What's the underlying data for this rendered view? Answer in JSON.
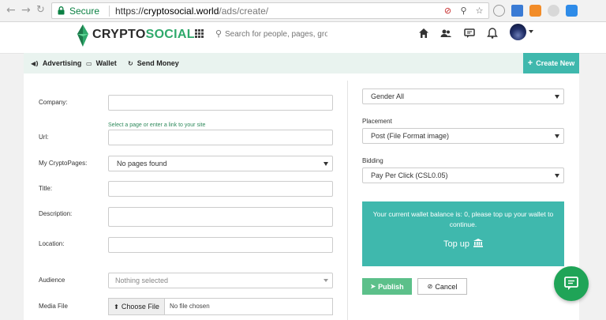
{
  "browser": {
    "secure_label": "Secure",
    "url_scheme": "https://",
    "url_host": "cryptosocial.world",
    "url_path": "/ads/create/"
  },
  "header": {
    "logo_part1": "CRYPTO",
    "logo_part2": "SOCIAL",
    "search_placeholder": "Search for people, pages, groups"
  },
  "subnav": {
    "advertising": "Advertising",
    "wallet": "Wallet",
    "send_money": "Send Money",
    "create_new": "Create New"
  },
  "form": {
    "company_label": "Company:",
    "url_hint": "Select a page or enter a link to your site",
    "url_label": "Url:",
    "cryptopages_label": "My CryptoPages:",
    "cryptopages_value": "No pages found",
    "title_label": "Title:",
    "description_label": "Description:",
    "location_label": "Location:",
    "audience_label": "Audience",
    "audience_value": "Nothing selected",
    "media_label": "Media File",
    "choose_file": "Choose File",
    "no_file": "No file chosen"
  },
  "right": {
    "gender_value": "Gender All",
    "placement_label": "Placement",
    "placement_value": "Post (File Format image)",
    "bidding_label": "Bidding",
    "bidding_value": "Pay Per Click (CSL0.05)",
    "wallet_message": "Your current wallet balance is: 0, please top up your wallet to continue.",
    "topup_label": "Top up",
    "publish_label": "Publish",
    "cancel_label": "Cancel"
  },
  "colors": {
    "accent_teal": "#3fb8ad",
    "brand_green": "#2fa96b",
    "publish_green": "#5cc08a",
    "chat_green": "#1fa457"
  }
}
